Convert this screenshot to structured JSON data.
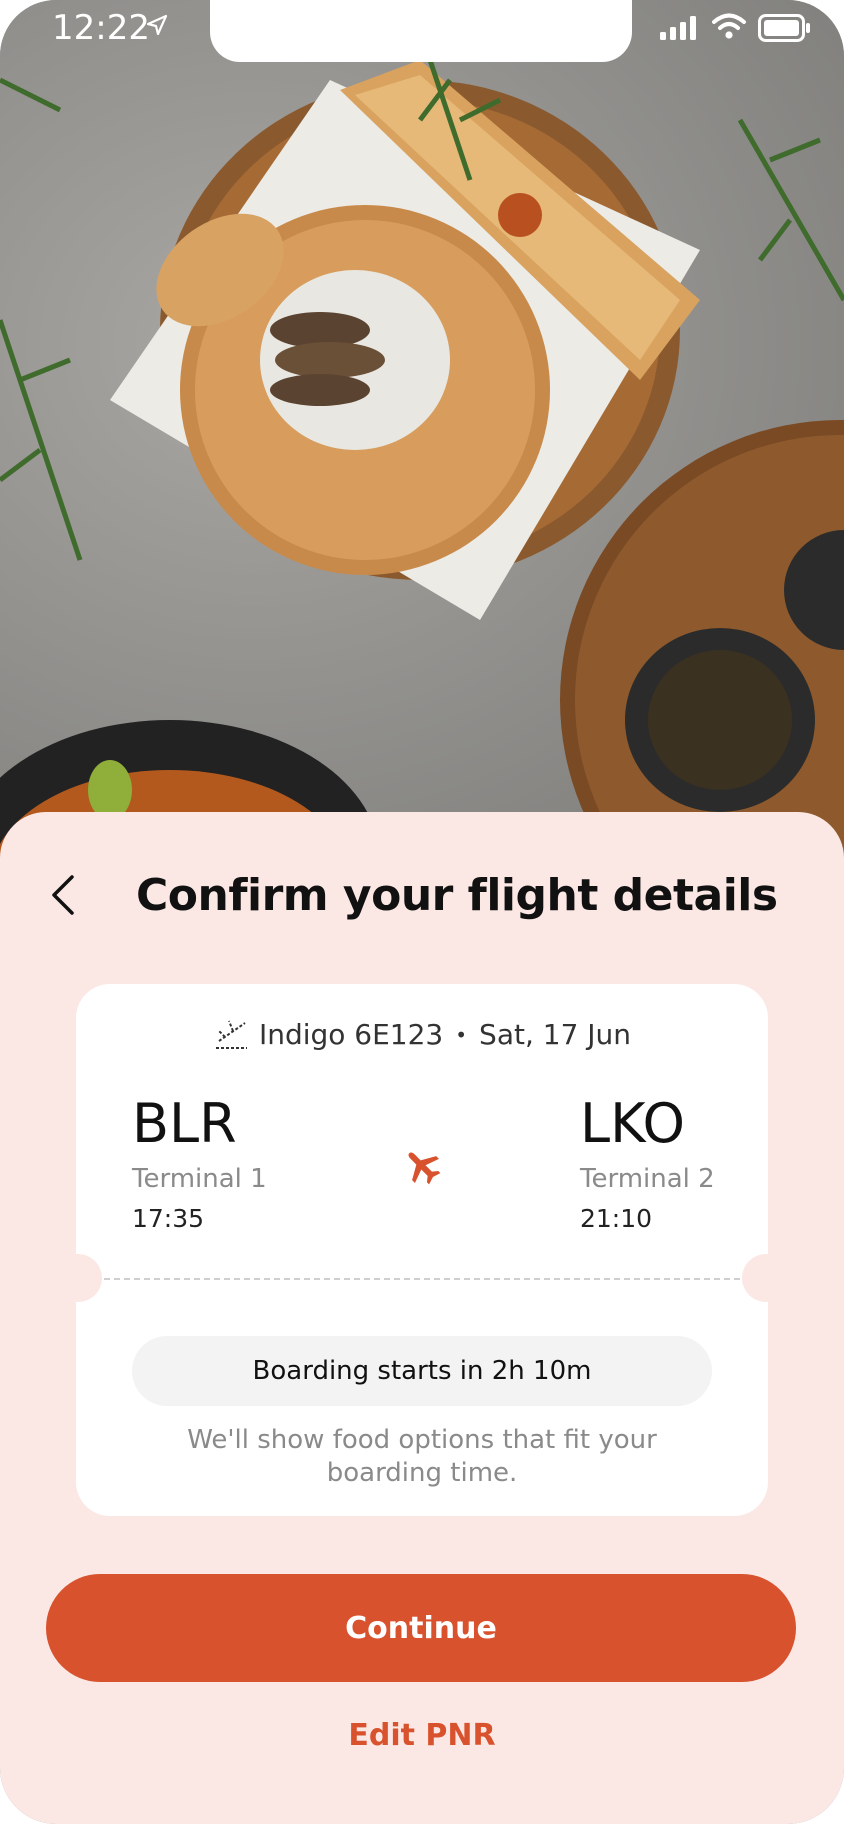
{
  "status_bar": {
    "time": "12:22"
  },
  "sheet": {
    "title": "Confirm your flight details"
  },
  "flight": {
    "airline": "Indigo 6E123",
    "separator": "•",
    "date": "Sat, 17 Jun",
    "origin": {
      "code": "BLR",
      "terminal": "Terminal 1",
      "time": "17:35"
    },
    "destination": {
      "code": "LKO",
      "terminal": "Terminal 2",
      "time": "21:10"
    }
  },
  "boarding": {
    "label": "Boarding starts in 2h 10m",
    "note": "We'll show food options that fit your boarding time."
  },
  "actions": {
    "continue_label": "Continue",
    "edit_label": "Edit PNR"
  },
  "colors": {
    "accent": "#d8522e",
    "sheet_bg": "#fbe8e4",
    "card_bg": "#ffffff"
  },
  "icons": [
    "location-arrow-icon",
    "signal-icon",
    "wifi-icon",
    "battery-icon",
    "back-arrow-icon",
    "takeoff-icon",
    "plane-icon"
  ]
}
